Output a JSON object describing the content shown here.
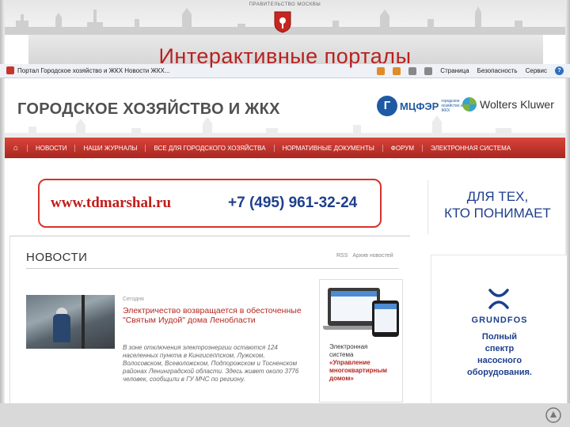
{
  "slide": {
    "government_label": "ПРАВИТЕЛЬСТВО МОСКВЫ",
    "title": "Интерактивные порталы"
  },
  "browser": {
    "tab_title": "Портал Городское хозяйство и ЖКХ Новости ЖКХ...",
    "toolbar": {
      "page_label": "Страница",
      "safety_label": "Безопасность",
      "tools_label": "Сервис",
      "help_label": "?"
    }
  },
  "site": {
    "name": "ГОРОДСКОЕ ХОЗЯЙСТВО И ЖКХ",
    "partner1_name": "МЦФЭР",
    "partner1_sub": "городское хозяйство и ЖКХ",
    "partner2_name": "Wolters Kluwer",
    "nav": [
      "НОВОСТИ",
      "НАШИ ЖУРНАЛЫ",
      "ВСЕ ДЛЯ ГОРОДСКОГО ХОЗЯЙСТВА",
      "НОРМАТИВНЫЕ ДОКУМЕНТЫ",
      "ФОРУМ",
      "ЭЛЕКТРОННАЯ СИСТЕМА"
    ]
  },
  "banner": {
    "url": "www.tdmarshal.ru",
    "phone": "+7 (495) 961-32-24"
  },
  "banner_right": {
    "line1": "ДЛЯ ТЕХ,",
    "line2": "КТО ПОНИМАЕТ"
  },
  "news": {
    "title": "НОВОСТИ",
    "rss_label": "RSS",
    "archive_label": "Архив новостей",
    "date": "Сегодня",
    "headline": "Электричество возвращается в обесточенные \"Святым Иудой\" дома Ленобласти",
    "text": "В зоне отключения электроэнергии остаются 124 населенных пункта в Кингисеппском, Лужском, Волосовском, Всеволожском, Подпорожском и Тосненском районах Ленинградской области. Здесь живет около 3776 человек, сообщили в ГУ МЧС по региону."
  },
  "promo": {
    "line1": "Электронная",
    "line2": "система",
    "line3": "«Управление многоквартирным домом»"
  },
  "grundfos": {
    "name": "GRUNDFOS",
    "line1": "Полный",
    "line2": "спектр",
    "line3": "насосного",
    "line4": "оборудования."
  },
  "colors": {
    "accent_red": "#b8211f",
    "nav_red": "#c0342c",
    "brand_blue": "#1e3f8c"
  }
}
